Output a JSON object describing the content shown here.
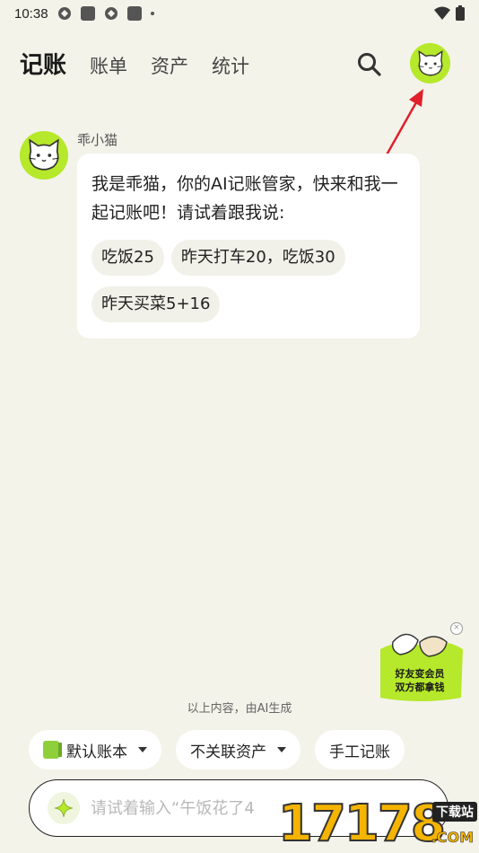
{
  "status_bar": {
    "time": "10:38",
    "icons": [
      "app-icon",
      "square-icon",
      "app-icon",
      "square-icon",
      "dot-icon"
    ],
    "right_icons": [
      "wifi-icon",
      "battery-icon"
    ]
  },
  "nav": {
    "tabs": [
      {
        "label": "记账",
        "active": true
      },
      {
        "label": "账单",
        "active": false
      },
      {
        "label": "资产",
        "active": false
      },
      {
        "label": "统计",
        "active": false
      }
    ],
    "search_icon": "search-icon",
    "avatar_icon": "cat-avatar-icon"
  },
  "chat": {
    "bot_name": "乖小猫",
    "message": "我是乖猫，你的AI记账管家，快来和我一起记账吧！请试着跟我说:",
    "suggestions": [
      "吃饭25",
      "昨天打车20，吃饭30",
      "昨天买菜5+16"
    ]
  },
  "promo": {
    "line1": "好友变会员",
    "line2": "双方都拿钱",
    "close_icon": "close-icon"
  },
  "ai_note": "以上内容，由AI生成",
  "selectors": {
    "ledger": "默认账本",
    "asset": "不关联资产",
    "manual": "手工记账"
  },
  "input": {
    "placeholder": "请试着输入“午饭花了4",
    "sparkle_icon": "sparkle-icon"
  },
  "watermark": {
    "digits": "17178",
    "badge": "下载站",
    "suffix": ".COM"
  },
  "colors": {
    "background": "#f3f3ea",
    "accent_green": "#b6e82b",
    "annotation_arrow": "#e0202a"
  }
}
